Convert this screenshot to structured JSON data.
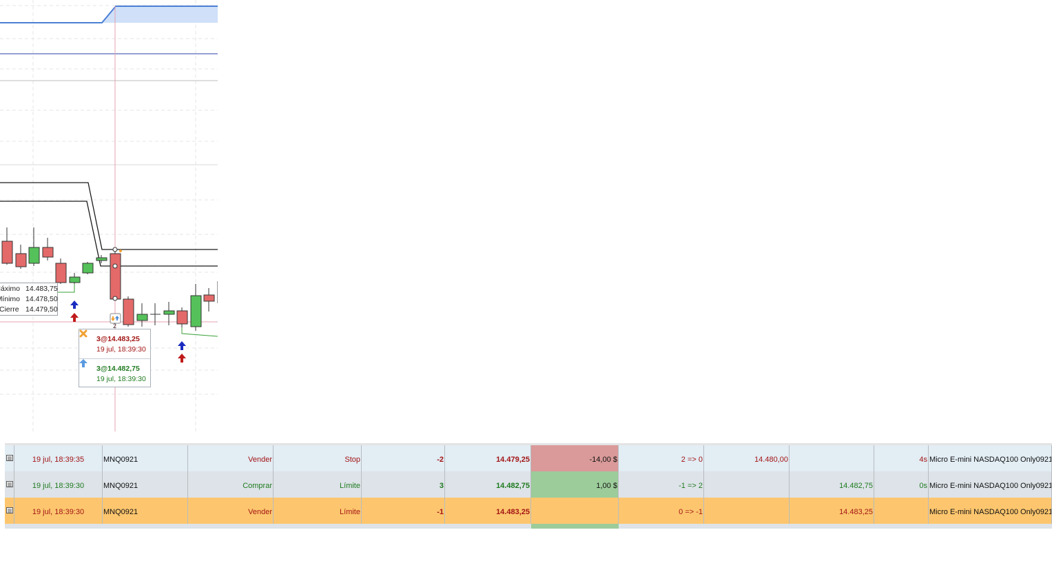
{
  "chart": {
    "info_panel": {
      "rows": [
        {
          "label": "Máximo",
          "value": "14.483,75"
        },
        {
          "label": "Mínimo",
          "value": "14.478,50"
        },
        {
          "label": "Cierre",
          "value": "14.479,50"
        }
      ]
    },
    "trade_popup": {
      "entries": [
        {
          "icon": "cancel-x-icon",
          "price": "3@14.483,25",
          "time": "19 jul, 18:39:30",
          "color": "#a31515"
        },
        {
          "icon": "buy-arrow-icon",
          "price": "3@14.482,75",
          "time": "19 jul, 18:39:30",
          "color": "#1f7a1f"
        }
      ]
    },
    "marker_count_label": "2",
    "colors": {
      "bull": "#55c15a",
      "bear": "#e46a6a",
      "crosshair": "#e6a0b0",
      "line": "#1a1a1a",
      "blue_line": "#4a7fd4"
    }
  },
  "trades_table": {
    "rows": [
      {
        "time": "19 jul, 18:39:35",
        "symbol": "MNQ0921",
        "side": "Vender",
        "type": "Stop",
        "qty": "-2",
        "price": "14.479,25",
        "pnl": "-14,00 $",
        "position": "2 => 0",
        "stop": "14.480,00",
        "limit": "",
        "duration": "4s",
        "account": "Micro E-mini NASDAQ100 Only0921",
        "tone": "red",
        "row_bg": "#e2edf4",
        "pnl_bg": "#d99a99"
      },
      {
        "time": "19 jul, 18:39:30",
        "symbol": "MNQ0921",
        "side": "Comprar",
        "type": "Límite",
        "qty": "3",
        "price": "14.482,75",
        "pnl": "1,00 $",
        "position": "-1 => 2",
        "stop": "",
        "limit": "14.482,75",
        "duration": "0s",
        "account": "Micro E-mini NASDAQ100 Only0921",
        "tone": "green",
        "row_bg": "#dde3e8",
        "pnl_bg": "#9ccc9a"
      },
      {
        "time": "19 jul, 18:39:30",
        "symbol": "MNQ0921",
        "side": "Vender",
        "type": "Límite",
        "qty": "-1",
        "price": "14.483,25",
        "pnl": "",
        "position": "0 => -1",
        "stop": "",
        "limit": "14.483,25",
        "duration": "",
        "account": "Micro E-mini NASDAQ100 Only0921",
        "tone": "red",
        "row_bg": "#fdc66e",
        "pnl_bg": "#fdc66e"
      }
    ]
  }
}
